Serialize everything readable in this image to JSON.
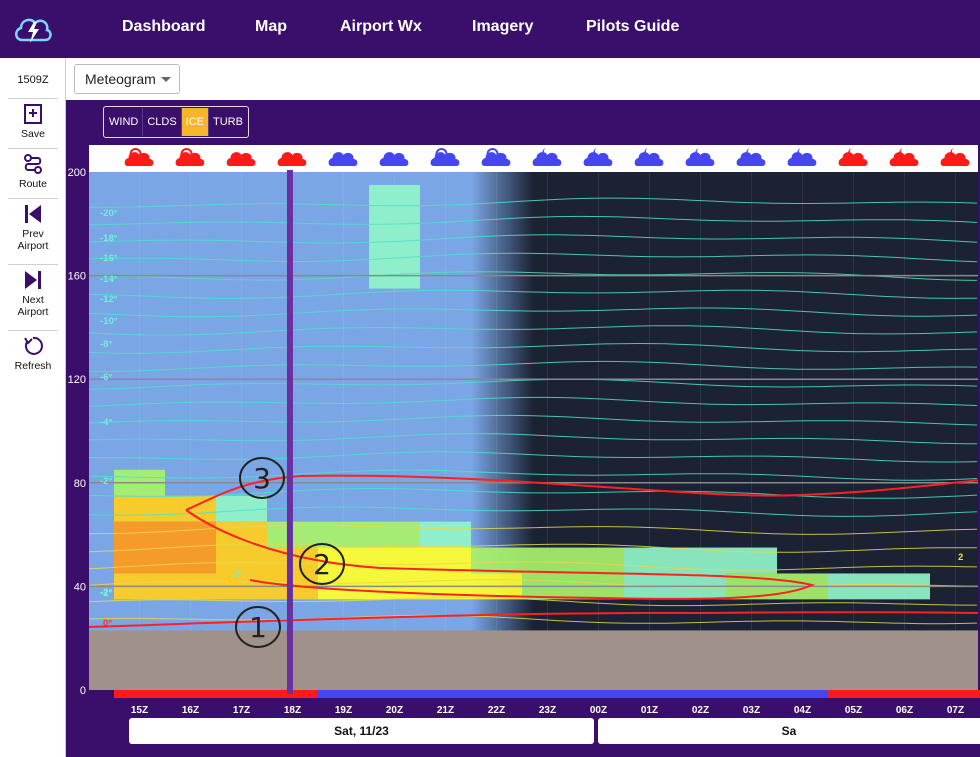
{
  "nav": {
    "items": [
      "Dashboard",
      "Map",
      "Airport Wx",
      "Imagery",
      "Pilots Guide"
    ]
  },
  "sidebar": {
    "time": "1509Z",
    "buttons": [
      {
        "label": "Save",
        "icon": "save-icon"
      },
      {
        "label": "Route",
        "icon": "route-icon"
      },
      {
        "label": "Prev Airport",
        "icon": "skip-back-icon"
      },
      {
        "label": "Next Airport",
        "icon": "skip-forward-icon"
      },
      {
        "label": "Refresh",
        "icon": "refresh-icon"
      }
    ]
  },
  "view_select": {
    "value": "Meteogram"
  },
  "layers": {
    "buttons": [
      "WIND",
      "CLDS",
      "ICE",
      "TURB"
    ],
    "active": "ICE"
  },
  "colors": {
    "brand": "#3a0f6b",
    "day_sky": "#7aa6e6",
    "night_sky": "#1b2233",
    "ground": "#a0928a",
    "vfr_red": "#ff1a1a",
    "ifr_blue": "#4646f0",
    "cursor": "#6a2fa0",
    "ice_trace": "#90f5c8",
    "ice_light": "#a8f26a",
    "ice_moderate": "#ffff2a",
    "ice_mod_severe": "#ffcf1c",
    "ice_severe": "#ff9a1a"
  },
  "chart_data": {
    "type": "heatmap",
    "y_axis": {
      "ticks": [
        0,
        40,
        80,
        120,
        160,
        200
      ],
      "ylim": [
        0,
        200
      ]
    },
    "time_labels": [
      "15Z",
      "16Z",
      "17Z",
      "18Z",
      "19Z",
      "20Z",
      "21Z",
      "22Z",
      "23Z",
      "00Z",
      "01Z",
      "02Z",
      "03Z",
      "04Z",
      "05Z",
      "06Z",
      "07Z"
    ],
    "weather_icons": [
      "partly-cloudy-day-red",
      "partly-cloudy-day-red",
      "cloud-red",
      "cloud-red",
      "cloud-blue",
      "cloud-blue",
      "partly-cloudy-day-blue",
      "partly-cloudy-day-blue",
      "partly-cloudy-night-blue",
      "partly-cloudy-night-blue",
      "partly-cloudy-night-blue",
      "partly-cloudy-night-blue",
      "partly-cloudy-night-blue",
      "partly-cloudy-night-blue",
      "partly-cloudy-night-red",
      "partly-cloudy-night-red",
      "partly-cloudy-night-red"
    ],
    "temperature_labels": [
      "-20°",
      "-18°",
      "-16°",
      "-14°",
      "-12°",
      "-10°",
      "-8°",
      "-6°",
      "-4°",
      "-2°",
      "-2°",
      "-2°",
      "0°",
      "-2°",
      "2"
    ],
    "ground_level": 23,
    "cursor_time_index": 3.45,
    "flight_category_bar": [
      {
        "from": 0,
        "to": 4,
        "category": "red"
      },
      {
        "from": 4,
        "to": 14,
        "category": "blue"
      },
      {
        "from": 14,
        "to": 17,
        "category": "red"
      }
    ],
    "annotations": [
      "1",
      "2",
      "3"
    ],
    "icing_cells": [
      {
        "t": 0,
        "lo": 75,
        "hi": 85,
        "level": "light"
      },
      {
        "t": 0,
        "lo": 65,
        "hi": 75,
        "level": "mod_severe"
      },
      {
        "t": 0,
        "lo": 45,
        "hi": 65,
        "level": "severe"
      },
      {
        "t": 0,
        "lo": 35,
        "hi": 45,
        "level": "mod_severe"
      },
      {
        "t": 1,
        "lo": 65,
        "hi": 75,
        "level": "mod_severe"
      },
      {
        "t": 1,
        "lo": 45,
        "hi": 65,
        "level": "severe"
      },
      {
        "t": 1,
        "lo": 35,
        "hi": 45,
        "level": "mod_severe"
      },
      {
        "t": 2,
        "lo": 65,
        "hi": 75,
        "level": "trace"
      },
      {
        "t": 2,
        "lo": 55,
        "hi": 65,
        "level": "mod_severe"
      },
      {
        "t": 2,
        "lo": 35,
        "hi": 55,
        "level": "mod_severe"
      },
      {
        "t": 3,
        "lo": 55,
        "hi": 65,
        "level": "light"
      },
      {
        "t": 3,
        "lo": 35,
        "hi": 55,
        "level": "mod_severe"
      },
      {
        "t": 4,
        "lo": 55,
        "hi": 65,
        "level": "light"
      },
      {
        "t": 4,
        "lo": 35,
        "hi": 55,
        "level": "moderate"
      },
      {
        "t": 5,
        "lo": 155,
        "hi": 195,
        "level": "trace"
      },
      {
        "t": 5,
        "lo": 55,
        "hi": 65,
        "level": "light"
      },
      {
        "t": 5,
        "lo": 35,
        "hi": 55,
        "level": "moderate"
      },
      {
        "t": 6,
        "lo": 55,
        "hi": 65,
        "level": "trace"
      },
      {
        "t": 6,
        "lo": 35,
        "hi": 55,
        "level": "moderate"
      },
      {
        "t": 7,
        "lo": 45,
        "hi": 55,
        "level": "light"
      },
      {
        "t": 7,
        "lo": 35,
        "hi": 45,
        "level": "moderate"
      },
      {
        "t": 8,
        "lo": 35,
        "hi": 55,
        "level": "light"
      },
      {
        "t": 9,
        "lo": 35,
        "hi": 55,
        "level": "light"
      },
      {
        "t": 10,
        "lo": 35,
        "hi": 55,
        "level": "trace"
      },
      {
        "t": 11,
        "lo": 35,
        "hi": 55,
        "level": "trace"
      },
      {
        "t": 12,
        "lo": 45,
        "hi": 55,
        "level": "trace"
      },
      {
        "t": 12,
        "lo": 35,
        "hi": 45,
        "level": "light"
      },
      {
        "t": 13,
        "lo": 35,
        "hi": 45,
        "level": "light"
      },
      {
        "t": 14,
        "lo": 35,
        "hi": 45,
        "level": "trace"
      },
      {
        "t": 15,
        "lo": 35,
        "hi": 45,
        "level": "trace"
      }
    ]
  },
  "dates": [
    "Sat, 11/23",
    "Sa"
  ]
}
